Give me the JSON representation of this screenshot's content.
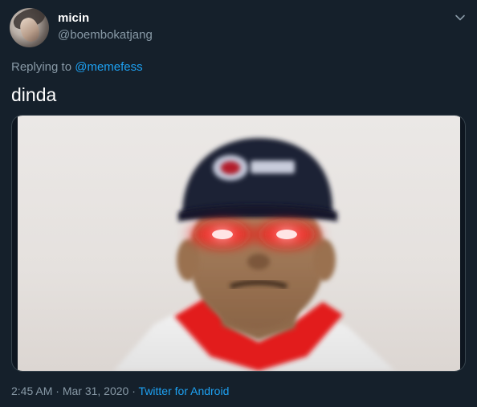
{
  "tweet": {
    "display_name": "micin",
    "handle": "@boembokatjang",
    "replying_prefix": "Replying to",
    "replying_to": "@memefess",
    "text": "dinda",
    "time": "2:45 AM",
    "separator": " · ",
    "date": "Mar 31, 2020",
    "source": "Twitter for Android"
  },
  "icons": {
    "menu": "chevron-down-icon"
  },
  "colors": {
    "background": "#15202b",
    "secondary_text": "#8899a6",
    "link": "#1da1f2",
    "laser_eyes": "#ff1a1a"
  }
}
